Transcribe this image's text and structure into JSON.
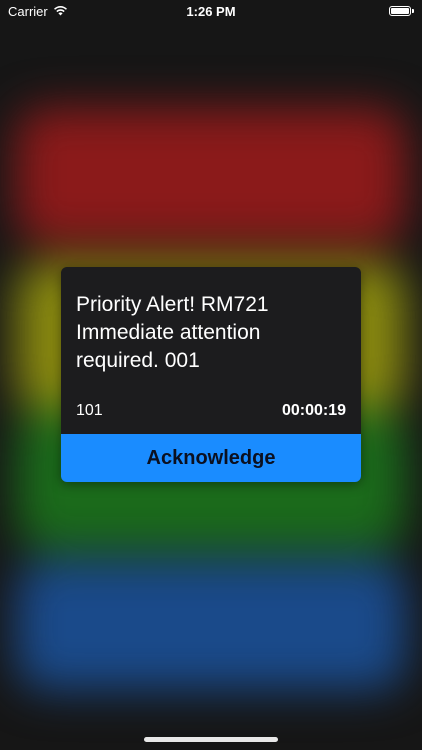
{
  "status_bar": {
    "carrier": "Carrier",
    "time": "1:26 PM",
    "battery_level": 1.0
  },
  "background_tiles": [
    {
      "name": "red",
      "color": "#8b1a1a"
    },
    {
      "name": "yellow",
      "color": "#8a8a10"
    },
    {
      "name": "green",
      "color": "#1b6b1b"
    },
    {
      "name": "blue",
      "color": "#1a4a8a"
    }
  ],
  "alert": {
    "message": "Priority Alert! RM721 Immediate attention required. 001",
    "code": "101",
    "timer": "00:00:19",
    "button_label": "Acknowledge"
  },
  "colors": {
    "card_bg": "#1c1c1e",
    "button_bg": "#1a8cff",
    "button_text": "#0b1020"
  }
}
